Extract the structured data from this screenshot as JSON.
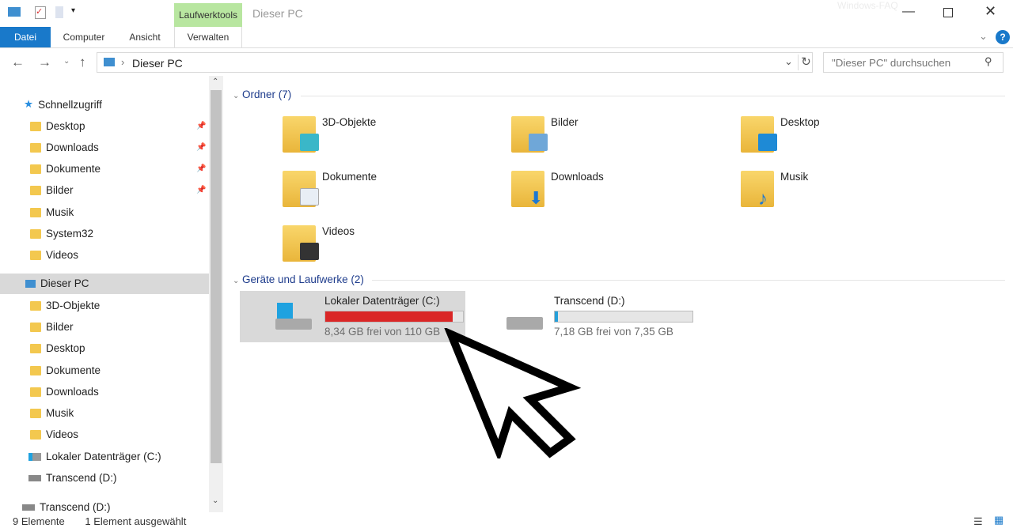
{
  "window": {
    "title": "Dieser PC",
    "watermark": "Windows-FAQ",
    "context_tab": "Laufwerktools"
  },
  "ribbon": {
    "tabs": [
      "Datei",
      "Computer",
      "Ansicht",
      "Verwalten"
    ]
  },
  "address": {
    "path": "Dieser PC"
  },
  "search": {
    "placeholder": "\"Dieser PC\" durchsuchen"
  },
  "sidebar": {
    "quick_access": "Schnellzugriff",
    "quick_items": [
      {
        "label": "Desktop",
        "pinned": true
      },
      {
        "label": "Downloads",
        "pinned": true
      },
      {
        "label": "Dokumente",
        "pinned": true
      },
      {
        "label": "Bilder",
        "pinned": true
      },
      {
        "label": "Musik"
      },
      {
        "label": "System32"
      },
      {
        "label": "Videos"
      }
    ],
    "this_pc": "Dieser PC",
    "pc_items": [
      "3D-Objekte",
      "Bilder",
      "Desktop",
      "Dokumente",
      "Downloads",
      "Musik",
      "Videos",
      "Lokaler Datenträger (C:)",
      "Transcend (D:)"
    ],
    "extra": "Transcend (D:)"
  },
  "main": {
    "folders_header": "Ordner (7)",
    "folders": [
      {
        "label": "3D-Objekte",
        "icon": "3d-objects-icon",
        "color": "#3ab7c8"
      },
      {
        "label": "Bilder",
        "icon": "pictures-icon",
        "color": "#6fa7d8"
      },
      {
        "label": "Desktop",
        "icon": "desktop-icon",
        "color": "#1e8ad6"
      },
      {
        "label": "Dokumente",
        "icon": "documents-icon",
        "color": "#e8eef5"
      },
      {
        "label": "Downloads",
        "icon": "downloads-icon",
        "color": "#1e78d0"
      },
      {
        "label": "Musik",
        "icon": "music-icon",
        "color": "#1e78d0"
      },
      {
        "label": "Videos",
        "icon": "videos-icon",
        "color": "#333333"
      }
    ],
    "drives_header": "Geräte und Laufwerke (2)",
    "drives": [
      {
        "label": "Lokaler Datenträger (C:)",
        "free": "8,34 GB frei von 110 GB",
        "used_fraction": 0.924,
        "bar_color": "#da2626",
        "selected": true
      },
      {
        "label": "Transcend (D:)",
        "free": "7,18 GB frei von 7,35 GB",
        "used_fraction": 0.023,
        "bar_color": "#26a0da",
        "selected": false
      }
    ]
  },
  "status": {
    "count": "9 Elemente",
    "selection": "1 Element ausgewählt"
  }
}
